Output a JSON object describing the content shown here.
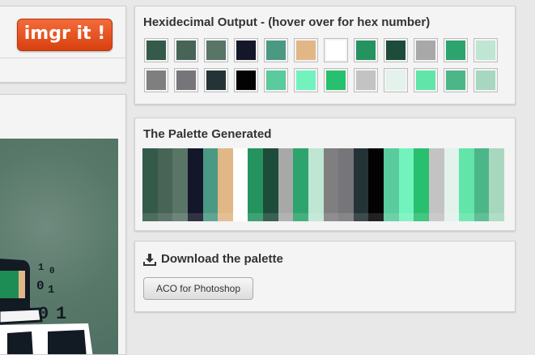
{
  "header": {
    "imgr_button_label": "imgr it !"
  },
  "hex_output": {
    "title": "Hexidecimal Output - (hover over for hex number)",
    "row1": [
      "#345a49",
      "#476457",
      "#587566",
      "#14162a",
      "#4a9983",
      "#e2b786",
      "#ffffff",
      "#25935f",
      "#1e4c3a",
      "#a8a8a8",
      "#2da46d",
      "#bfe5d3"
    ],
    "row2": [
      "#7f7f7f",
      "#76767a",
      "#243336",
      "#030303",
      "#59cb9c",
      "#72f3be",
      "#27c06e",
      "#c3c3c3",
      "#e3f2eb",
      "#61e5a9",
      "#4db688",
      "#a7d8bf"
    ]
  },
  "palette": {
    "title": "The Palette Generated",
    "colors": [
      "#345a49",
      "#476457",
      "#587566",
      "#14162a",
      "#4a9983",
      "#e2b786",
      "#ffffff",
      "#25935f",
      "#1e4c3a",
      "#a8a8a8",
      "#2da46d",
      "#bfe5d3",
      "#7f7f7f",
      "#76767a",
      "#243336",
      "#030303",
      "#59cb9c",
      "#72f3be",
      "#27c06e",
      "#c3c3c3",
      "#e3f2eb",
      "#61e5a9",
      "#4db688",
      "#a7d8bf"
    ]
  },
  "download": {
    "title": "Download the palette",
    "aco_button_label": "ACO for Photoshop"
  },
  "preview": {
    "binary_digits": [
      "1",
      "0",
      "0",
      "1",
      "0",
      "1"
    ]
  }
}
